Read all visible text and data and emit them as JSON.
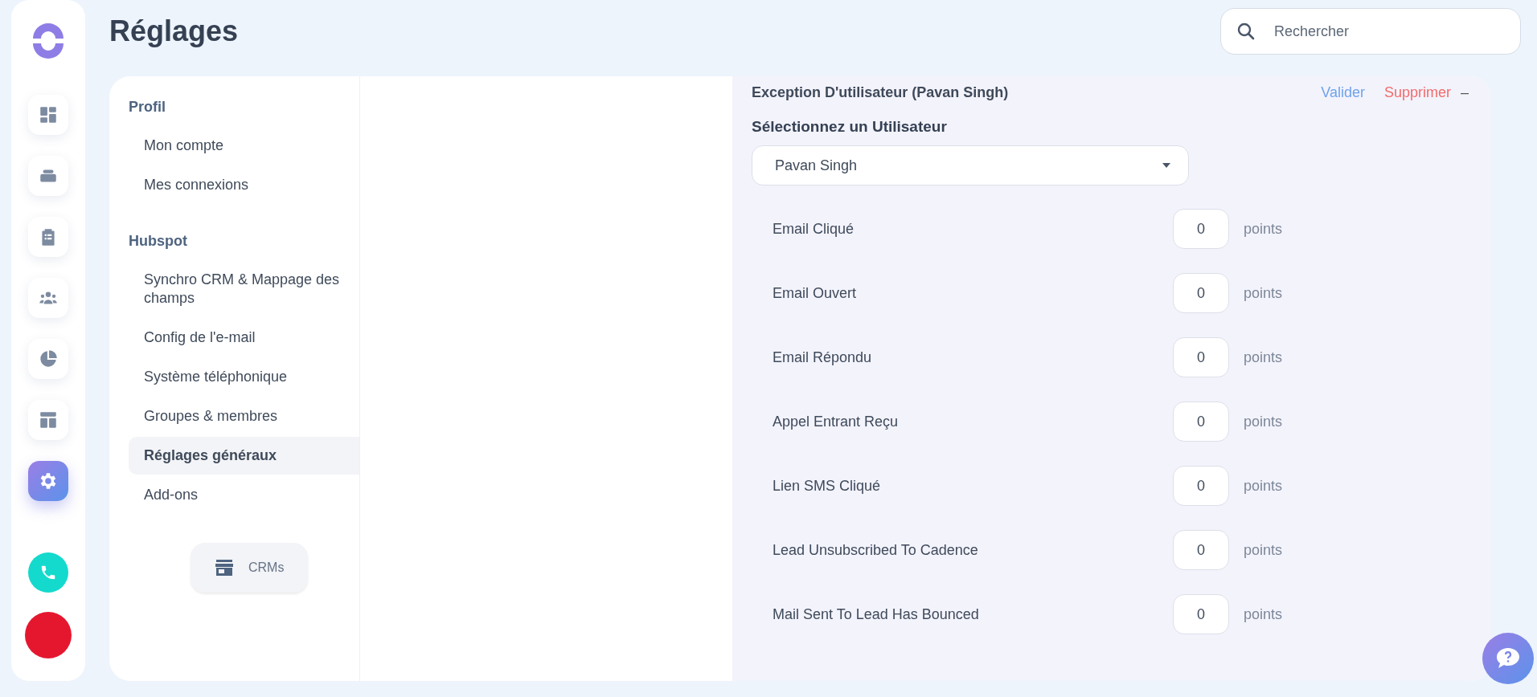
{
  "page": {
    "title": "Réglages"
  },
  "search": {
    "placeholder": "Rechercher"
  },
  "rail": {
    "items": [
      {
        "kind": "dashboard",
        "selected": false
      },
      {
        "kind": "inbox",
        "selected": false
      },
      {
        "kind": "clipboard",
        "selected": false
      },
      {
        "kind": "people",
        "selected": false
      },
      {
        "kind": "chart",
        "selected": false
      },
      {
        "kind": "layout",
        "selected": false
      },
      {
        "kind": "settings",
        "selected": true
      }
    ]
  },
  "menu": {
    "sections": [
      {
        "title": "Profil",
        "items": [
          {
            "label": "Mon compte",
            "selected": false
          },
          {
            "label": "Mes connexions",
            "selected": false
          }
        ]
      },
      {
        "title": "Hubspot",
        "items": [
          {
            "label": "Synchro CRM & Mappage des champs",
            "selected": false
          },
          {
            "label": "Config de l'e-mail",
            "selected": false
          },
          {
            "label": "Système téléphonique",
            "selected": false
          },
          {
            "label": "Groupes & membres",
            "selected": false
          },
          {
            "label": "Réglages généraux",
            "selected": true
          },
          {
            "label": "Add-ons",
            "selected": false
          }
        ]
      }
    ],
    "crm_button": {
      "label": "CRMs"
    }
  },
  "exception": {
    "title": "Exception D'utilisateur (Pavan Singh)",
    "actions": [
      {
        "label": "Valider",
        "kind": "confirm"
      },
      {
        "label": "Supprimer",
        "kind": "delete"
      },
      {
        "label": "–",
        "kind": "collapse"
      }
    ],
    "user_label": "Sélectionnez un Utilisateur",
    "user_value": "Pavan Singh",
    "rows": [
      {
        "label": "Email Cliqué",
        "value": "0",
        "unit": "points"
      },
      {
        "label": "Email Ouvert",
        "value": "0",
        "unit": "points"
      },
      {
        "label": "Email Répondu",
        "value": "0",
        "unit": "points"
      },
      {
        "label": "Appel Entrant Reçu",
        "value": "0",
        "unit": "points"
      },
      {
        "label": "Lien SMS Cliqué",
        "value": "0",
        "unit": "points"
      },
      {
        "label": "Lead Unsubscribed To Cadence",
        "value": "0",
        "unit": "points"
      },
      {
        "label": "Mail Sent To Lead Has Bounced",
        "value": "0",
        "unit": "points"
      }
    ]
  }
}
